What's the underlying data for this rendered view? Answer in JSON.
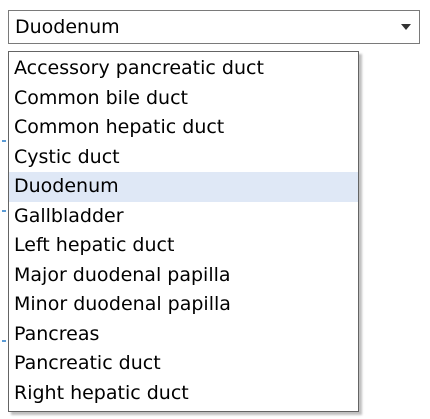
{
  "combo": {
    "selected_value": "Duodenum"
  },
  "options": [
    "Accessory pancreatic duct",
    "Common bile duct",
    "Common hepatic duct",
    "Cystic duct",
    "Duodenum",
    "Gallbladder",
    "Left hepatic duct",
    "Major duodenal papilla",
    "Minor duodenal papilla",
    "Pancreas",
    "Pancreatic duct",
    "Right hepatic duct"
  ],
  "selected_index": 4,
  "colors": {
    "selected_highlight": "#dfe8f6",
    "border": "#7a7a7a"
  }
}
